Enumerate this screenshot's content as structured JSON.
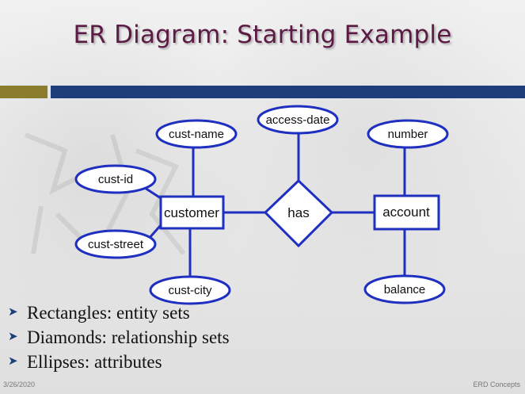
{
  "slide": {
    "title": "ER Diagram: Starting Example",
    "footer_date": "3/26/2020",
    "footer_topic": "ERD Concepts"
  },
  "colors": {
    "title": "#5c1b44",
    "shape_stroke": "#1f2fbf",
    "bar_gold": "#8a7d2d",
    "bar_blue": "#1d3e78"
  },
  "diagram": {
    "entities": [
      {
        "id": "customer",
        "label": "customer"
      },
      {
        "id": "account",
        "label": "account"
      }
    ],
    "relationships": [
      {
        "id": "has",
        "label": "has"
      }
    ],
    "attributes": [
      {
        "id": "cust-name",
        "label": "cust-name",
        "of": "customer"
      },
      {
        "id": "cust-id",
        "label": "cust-id",
        "of": "customer"
      },
      {
        "id": "cust-street",
        "label": "cust-street",
        "of": "customer"
      },
      {
        "id": "cust-city",
        "label": "cust-city",
        "of": "customer"
      },
      {
        "id": "access-date",
        "label": "access-date",
        "of": "has"
      },
      {
        "id": "number",
        "label": "number",
        "of": "account"
      },
      {
        "id": "balance",
        "label": "balance",
        "of": "account"
      }
    ],
    "links": [
      {
        "from": "customer",
        "to": "has"
      },
      {
        "from": "has",
        "to": "account"
      }
    ]
  },
  "bullets": [
    {
      "text": "Rectangles: entity sets",
      "icon": "chevron-right-icon"
    },
    {
      "text": "Diamonds: relationship sets",
      "icon": "chevron-right-icon"
    },
    {
      "text": "Ellipses: attributes",
      "icon": "chevron-right-icon"
    }
  ]
}
